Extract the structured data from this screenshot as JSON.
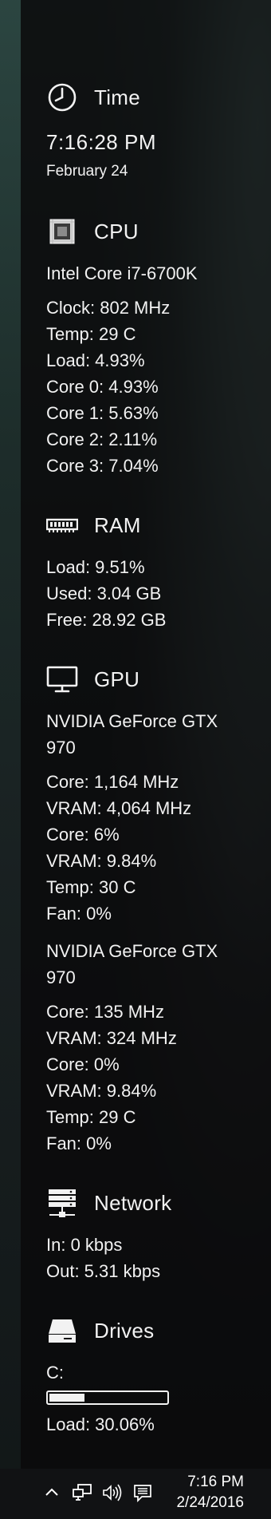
{
  "time": {
    "title": "Time",
    "icon": "clock-icon",
    "clock": "7:16:28 PM",
    "date": "February 24"
  },
  "cpu": {
    "title": "CPU",
    "icon": "cpu-icon",
    "model": "Intel Core i7-6700K",
    "lines": [
      "Clock: 802 MHz",
      "Temp: 29 C",
      "Load: 4.93%",
      "Core 0: 4.93%",
      "Core 1: 5.63%",
      "Core 2: 2.11%",
      "Core 3: 7.04%"
    ]
  },
  "ram": {
    "title": "RAM",
    "icon": "memory-icon",
    "lines": [
      "Load: 9.51%",
      "Used: 3.04 GB",
      "Free: 28.92 GB"
    ]
  },
  "gpu": {
    "title": "GPU",
    "icon": "monitor-icon",
    "cards": [
      {
        "name": "NVIDIA GeForce GTX 970",
        "lines": [
          "Core: 1,164 MHz",
          "VRAM: 4,064 MHz",
          "Core: 6%",
          "VRAM: 9.84%",
          "Temp: 30 C",
          "Fan: 0%"
        ]
      },
      {
        "name": "NVIDIA GeForce GTX 970",
        "lines": [
          "Core: 135 MHz",
          "VRAM: 324 MHz",
          "Core: 0%",
          "VRAM: 9.84%",
          "Temp: 29 C",
          "Fan: 0%"
        ]
      }
    ]
  },
  "network": {
    "title": "Network",
    "icon": "network-icon",
    "lines": [
      "In: 0 kbps",
      "Out: 5.31 kbps"
    ]
  },
  "drives": {
    "title": "Drives",
    "icon": "drive-icon",
    "drive_label": "C:",
    "usage_fraction": 0.3,
    "load": "Load: 30.06%"
  },
  "taskbar": {
    "tray_icons": [
      "chevron-up-icon",
      "network-tray-icon",
      "volume-icon",
      "action-center-icon"
    ],
    "time": "7:16 PM",
    "date": "2/24/2016"
  },
  "colors": {
    "text": "#f2f2f2",
    "panel_bg": "#0c0c0e",
    "taskbar_bg": "#111214"
  }
}
